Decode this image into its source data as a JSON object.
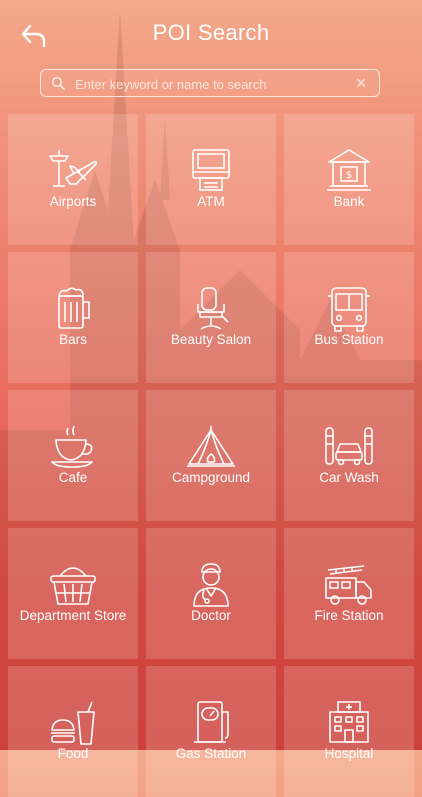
{
  "header": {
    "title": "POI Search"
  },
  "search": {
    "placeholder": "Enter keyword or name to search",
    "value": ""
  },
  "categories": [
    {
      "label": "Airports",
      "icon": "airport-icon"
    },
    {
      "label": "ATM",
      "icon": "atm-icon"
    },
    {
      "label": "Bank",
      "icon": "bank-icon"
    },
    {
      "label": "Bars",
      "icon": "beer-mug-icon"
    },
    {
      "label": "Beauty Salon",
      "icon": "salon-chair-icon"
    },
    {
      "label": "Bus Station",
      "icon": "bus-icon"
    },
    {
      "label": "Cafe",
      "icon": "coffee-cup-icon"
    },
    {
      "label": "Campground",
      "icon": "tent-icon"
    },
    {
      "label": "Car Wash",
      "icon": "car-wash-icon"
    },
    {
      "label": "Department Store",
      "icon": "shopping-basket-icon"
    },
    {
      "label": "Doctor",
      "icon": "doctor-icon"
    },
    {
      "label": "Fire Station",
      "icon": "fire-truck-icon"
    },
    {
      "label": "Food",
      "icon": "fast-food-icon"
    },
    {
      "label": "Gas Station",
      "icon": "gas-pump-icon"
    },
    {
      "label": "Hospital",
      "icon": "hospital-icon"
    }
  ],
  "colors": {
    "gradient_top": "#f4a98b",
    "gradient_bottom": "#de4540",
    "tile_overlay": "rgba(255,255,255,0.17)"
  }
}
